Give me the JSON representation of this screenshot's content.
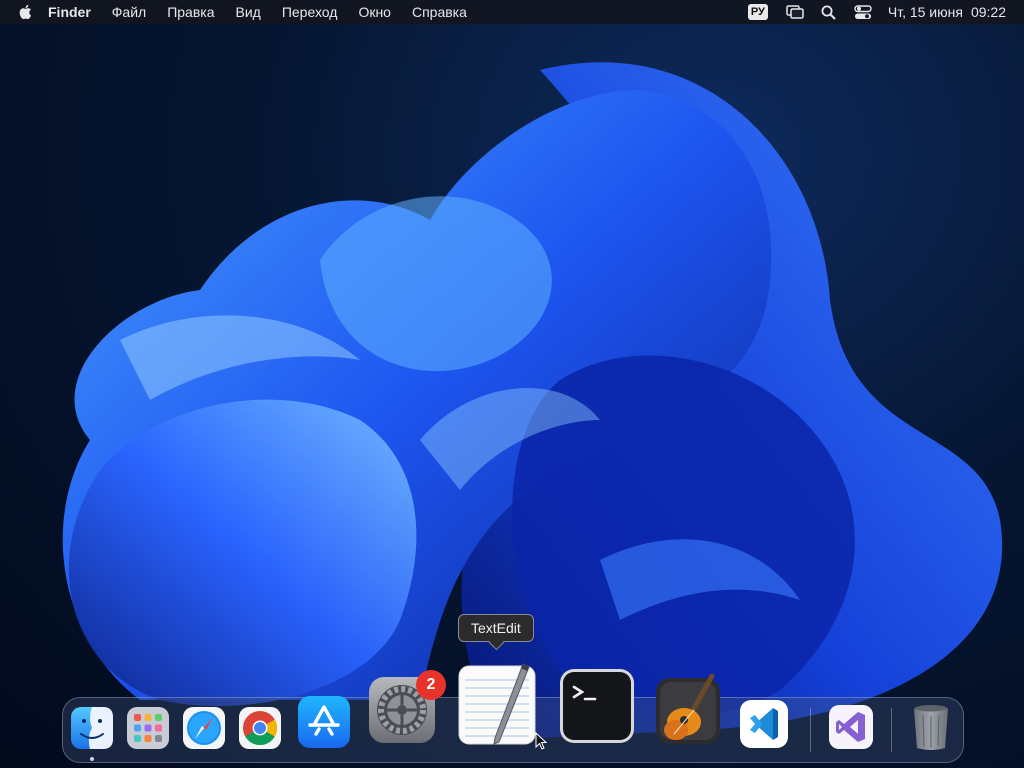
{
  "menubar": {
    "apple_icon": "apple-logo",
    "app_name": "Finder",
    "menus": [
      "Файл",
      "Правка",
      "Вид",
      "Переход",
      "Окно",
      "Справка"
    ],
    "input_source": "РУ",
    "tray_icons": [
      "screen-mirroring-icon",
      "search-icon",
      "control-center-icon"
    ],
    "date": "Чт, 15 июня",
    "time": "09:22"
  },
  "tooltip": {
    "text": "TextEdit"
  },
  "dock": {
    "apps": [
      {
        "name": "Finder",
        "icon": "finder-icon",
        "running": true
      },
      {
        "name": "Launchpad",
        "icon": "launchpad-icon"
      },
      {
        "name": "Safari",
        "icon": "safari-icon"
      },
      {
        "name": "Google Chrome",
        "icon": "chrome-icon"
      },
      {
        "name": "App Store",
        "icon": "app-store-icon"
      },
      {
        "name": "System Preferences",
        "icon": "gear-icon",
        "badge": "2"
      },
      {
        "name": "TextEdit",
        "icon": "textedit-icon",
        "hovered": true
      },
      {
        "name": "Terminal",
        "icon": "terminal-icon"
      },
      {
        "name": "GarageBand",
        "icon": "guitar-icon"
      },
      {
        "name": "Visual Studio Code",
        "icon": "vscode-icon"
      },
      {
        "name": "Visual Studio",
        "icon": "visual-studio-icon"
      },
      {
        "name": "Trash",
        "icon": "trash-icon"
      }
    ],
    "badge_count": "2"
  },
  "colors": {
    "wallpaper_accent": "#1f5cff",
    "badge": "#e8332b",
    "dock_tint": "#46557d"
  }
}
